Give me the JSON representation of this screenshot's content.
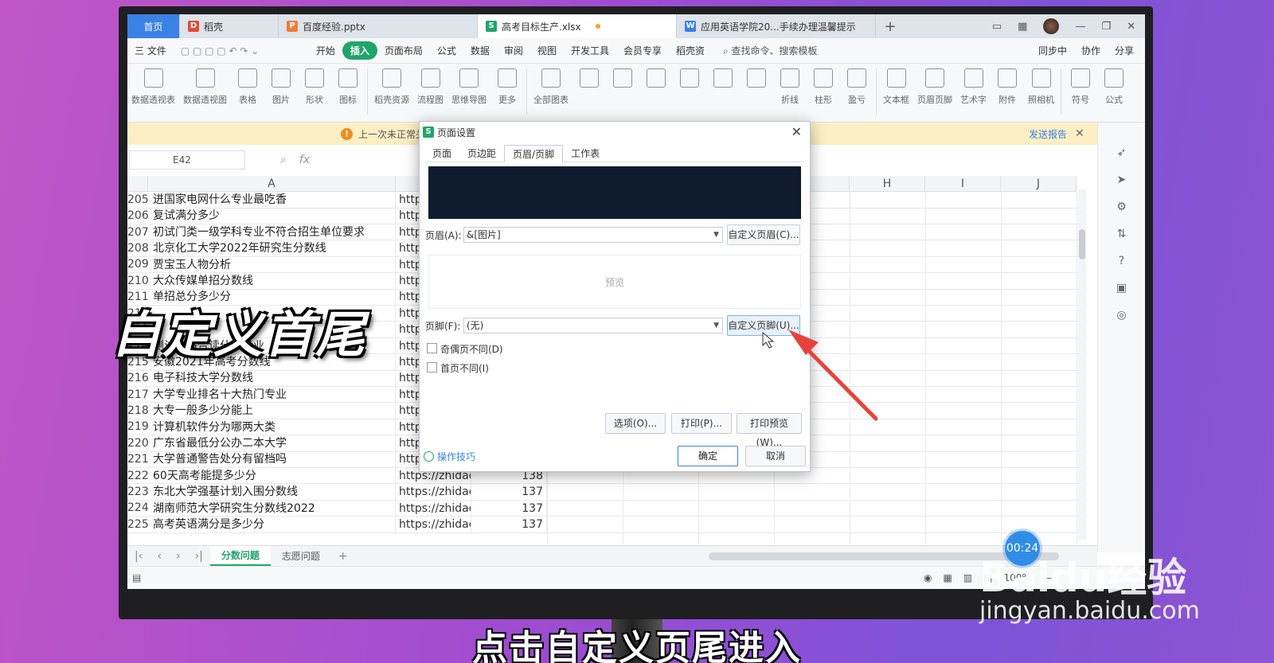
{
  "tabs": [
    {
      "label": "首页"
    },
    {
      "label": "稻壳",
      "icon": "docer-icon",
      "color": "#e64a3a"
    },
    {
      "label": "百度经验.pptx",
      "icon": "ppt-icon",
      "color": "#f07a3a"
    },
    {
      "label": "高考目标生产.xlsx",
      "icon": "sheet-icon",
      "color": "#1fa56b"
    },
    {
      "label": "应用英语学院20...手续办理温馨提示",
      "icon": "word-icon",
      "color": "#3a82e6"
    }
  ],
  "menu": {
    "file": "三 文件",
    "items": [
      "开始",
      "插入",
      "页面布局",
      "公式",
      "数据",
      "审阅",
      "视图",
      "开发工具",
      "会员专享",
      "稻壳资"
    ],
    "active": "插入",
    "search": "查找命令、搜索模板",
    "right": [
      "同步中",
      "协作",
      "分享"
    ]
  },
  "ribbon": [
    "数据透视表",
    "数据透视图",
    "表格",
    "图片",
    "形状",
    "图标",
    "稻壳资源",
    "流程图",
    "思维导图",
    "更多",
    "全部图表",
    "",
    "",
    "",
    "",
    "",
    "",
    "折线",
    "柱形",
    "盈亏",
    "文本框",
    "页眉页脚",
    "艺术字",
    "附件",
    "照相机",
    "符号",
    "公式"
  ],
  "notice": {
    "text": "上一次未正常关",
    "report": "发送报告"
  },
  "namebox": "E42",
  "columns": [
    "A",
    "H",
    "I",
    "J"
  ],
  "rows": [
    {
      "n": "205",
      "a": "进国家电网什么专业最吃香",
      "b": "http",
      "c": ""
    },
    {
      "n": "206",
      "a": "复试满分多少",
      "b": "http",
      "c": ""
    },
    {
      "n": "207",
      "a": "初试门类一级学科专业不符合招生单位要求",
      "b": "http",
      "c": ""
    },
    {
      "n": "208",
      "a": "北京化工大学2022年研究生分数线",
      "b": "http",
      "c": ""
    },
    {
      "n": "209",
      "a": "贾宝玉人物分析",
      "b": "http",
      "c": ""
    },
    {
      "n": "210",
      "a": "大众传媒单招分数线",
      "b": "http",
      "c": ""
    },
    {
      "n": "211",
      "a": "单招总分多少分",
      "b": "http",
      "c": ""
    },
    {
      "n": "212",
      "a": "",
      "b": "http",
      "c": ""
    },
    {
      "n": "213",
      "a": "",
      "b": "http",
      "c": ""
    },
    {
      "n": "214",
      "a": "测试你适合读什么专业",
      "b": "http",
      "c": ""
    },
    {
      "n": "215",
      "a": "安徽2021年高考分数线",
      "b": "http",
      "c": ""
    },
    {
      "n": "216",
      "a": "电子科技大学分数线",
      "b": "http",
      "c": ""
    },
    {
      "n": "217",
      "a": "大学专业排名十大热门专业",
      "b": "http",
      "c": ""
    },
    {
      "n": "218",
      "a": "大专一般多少分能上",
      "b": "http",
      "c": ""
    },
    {
      "n": "219",
      "a": "计算机软件分为哪两大类",
      "b": "http",
      "c": ""
    },
    {
      "n": "220",
      "a": "广东省最低分公办二本大学",
      "b": "http",
      "c": ""
    },
    {
      "n": "221",
      "a": "大学普通警告处分有留档吗",
      "b": "http",
      "c": ""
    },
    {
      "n": "222",
      "a": "60天高考能提多少分",
      "b": "https://zhidac",
      "c": "138"
    },
    {
      "n": "223",
      "a": "东北大学强基计划入围分数线",
      "b": "https://zhidac",
      "c": "137"
    },
    {
      "n": "224",
      "a": "湖南师范大学研究生分数线2022",
      "b": "https://zhidac",
      "c": "137"
    },
    {
      "n": "225",
      "a": "高考英语满分是多少分",
      "b": "https://zhidac",
      "c": "137"
    }
  ],
  "sheet_tabs": [
    "分数问题",
    "志愿问题"
  ],
  "status": {
    "zoom": "100%"
  },
  "dialog": {
    "title": "页面设置",
    "tabs": [
      "页面",
      "页边距",
      "页眉/页脚",
      "工作表"
    ],
    "active_tab": "页眉/页脚",
    "header_label": "页眉(A):",
    "header_value": "&[图片]",
    "custom_header": "自定义页眉(C)...",
    "preview_label": "预览",
    "footer_label": "页脚(F):",
    "footer_value": "(无)",
    "custom_footer": "自定义页脚(U)...",
    "odd_even": "奇偶页不同(D)",
    "first_page": "首页不同(I)",
    "options": "选项(O)...",
    "print": "打印(P)...",
    "print_preview": "打印预览(W)...",
    "tips": "操作技巧",
    "ok": "确定",
    "cancel": "取消"
  },
  "overlay": {
    "big_text": "自定义首尾",
    "subtitle": "点击自定义页尾进入",
    "timer": "00:24",
    "logo": "Baidu经验",
    "url": "jingyan.baidu.com"
  }
}
